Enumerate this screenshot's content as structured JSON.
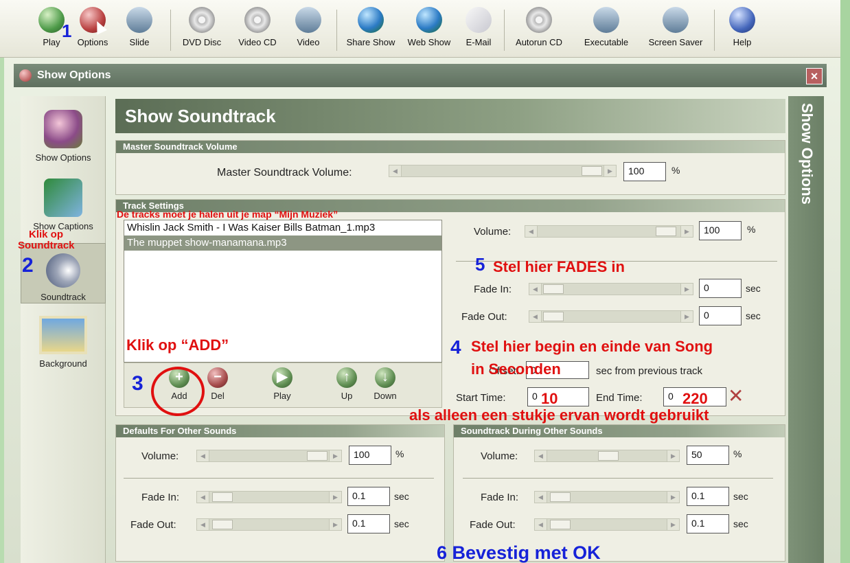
{
  "toolbar": {
    "items": [
      {
        "label": "Play",
        "icon": "play-icon"
      },
      {
        "label": "Options",
        "icon": "options-icon"
      },
      {
        "label": "Slide",
        "icon": "slide-icon"
      },
      {
        "label": "DVD Disc",
        "icon": "dvd-disc-icon"
      },
      {
        "label": "Video CD",
        "icon": "video-cd-icon"
      },
      {
        "label": "Video",
        "icon": "video-icon"
      },
      {
        "label": "Share Show",
        "icon": "share-show-icon"
      },
      {
        "label": "Web Show",
        "icon": "web-show-icon"
      },
      {
        "label": "E-Mail",
        "icon": "email-icon"
      },
      {
        "label": "Autorun CD",
        "icon": "autorun-cd-icon"
      },
      {
        "label": "Executable",
        "icon": "executable-icon"
      },
      {
        "label": "Screen Saver",
        "icon": "screen-saver-icon"
      },
      {
        "label": "Help",
        "icon": "help-icon"
      }
    ],
    "annotation_num": "1"
  },
  "window": {
    "title": "Show Options",
    "side_tab": "Show Options",
    "close": "×"
  },
  "sidebar": {
    "items": [
      {
        "label": "Show Options",
        "icon": "show-options-icon"
      },
      {
        "label": "Show Captions",
        "icon": "show-captions-icon"
      },
      {
        "label": "Soundtrack",
        "icon": "soundtrack-icon"
      },
      {
        "label": "Background",
        "icon": "background-icon"
      }
    ]
  },
  "heading": "Show Soundtrack",
  "master": {
    "group_title": "Master Soundtrack Volume",
    "label": "Master Soundtrack Volume:",
    "value": "100",
    "unit": "%"
  },
  "track_settings": {
    "group_title": "Track Settings",
    "tracks": [
      "Whislin Jack Smith - I Was Kaiser Bills Batman_1.mp3",
      "The muppet show-manamana.mp3"
    ],
    "selected_index": 1,
    "buttons": {
      "add": "Add",
      "del": "Del",
      "play": "Play",
      "up": "Up",
      "down": "Down"
    },
    "volume_label": "Volume:",
    "volume_value": "100",
    "volume_unit": "%",
    "fade_in_label": "Fade In:",
    "fade_in_value": "0",
    "fade_in_unit": "sec",
    "fade_out_label": "Fade Out:",
    "fade_out_value": "0",
    "fade_out_unit": "sec",
    "offset_label": "Offset:",
    "offset_value": "0",
    "offset_suffix": "sec from previous track",
    "start_label": "Start Time:",
    "start_value": "0",
    "end_label": "End Time:",
    "end_value": "0"
  },
  "defaults": {
    "group_title": "Defaults For Other Sounds",
    "volume_label": "Volume:",
    "volume_value": "100",
    "volume_unit": "%",
    "fade_in_label": "Fade In:",
    "fade_in_value": "0.1",
    "fade_in_unit": "sec",
    "fade_out_label": "Fade Out:",
    "fade_out_value": "0.1",
    "fade_out_unit": "sec"
  },
  "during": {
    "group_title": "Soundtrack During Other Sounds",
    "volume_label": "Volume:",
    "volume_value": "50",
    "volume_unit": "%",
    "fade_in_label": "Fade In:",
    "fade_in_value": "0.1",
    "fade_in_unit": "sec",
    "fade_out_label": "Fade Out:",
    "fade_out_value": "0.1",
    "fade_out_unit": "sec"
  },
  "annotations": {
    "tracks_note": "De tracks moet je halen uit je map “Mijn Muziek”",
    "klik_op": "Klik op",
    "soundtrack": "Soundtrack",
    "n2": "2",
    "klik_add": "Klik op “ADD”",
    "n3": "3",
    "n5": "5",
    "fades": "Stel hier FADES in",
    "n4": "4",
    "begin_einde": "Stel hier begin en einde van Song",
    "in_seconden": "in Seconden",
    "start_10": "10",
    "end_220": "220",
    "alleen": "als alleen een stukje ervan wordt gebruikt",
    "n6": "6 Bevestig met OK"
  },
  "colors": {
    "annotation_red": "#e01010",
    "annotation_blue": "#1622d8",
    "accent_green": "#6e7f68"
  }
}
